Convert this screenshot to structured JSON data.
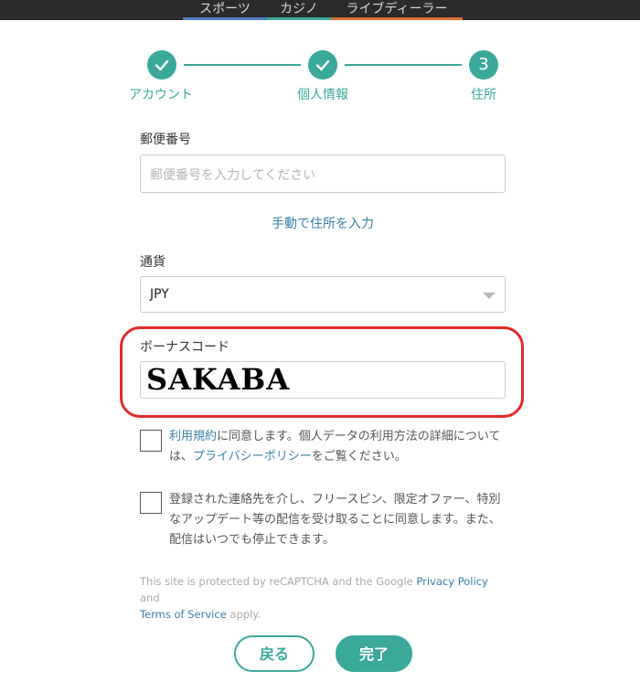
{
  "tabs": {
    "sports": "スポーツ",
    "casino": "カジノ",
    "live_dealer": "ライブディーラー"
  },
  "stepper": {
    "steps": [
      {
        "label": "アカウント",
        "state": "done"
      },
      {
        "label": "個人情報",
        "state": "done"
      },
      {
        "label": "住所",
        "state": "current",
        "number": "3"
      }
    ]
  },
  "postal": {
    "label": "郵便番号",
    "placeholder": "郵便番号を入力してください",
    "manual_link": "手動で住所を入力"
  },
  "currency": {
    "label": "通貨",
    "selected": "JPY"
  },
  "bonus": {
    "label": "ボーナスコード",
    "value": "SAKABA"
  },
  "terms": {
    "link1": "利用規約",
    "text1": "に同意します。個人データの利用方法の詳細については、",
    "link2": "プライバシーポリシー",
    "text2": "をご覧ください。"
  },
  "marketing": {
    "text": "登録された連絡先を介し、フリースピン、限定オファー、特別なアップデート等の配信を受け取ることに同意します。また、配信はいつでも停止できます。"
  },
  "recaptcha": {
    "text1": "This site is protected by reCAPTCHA and the Google ",
    "privacy": "Privacy Policy",
    "and": " and ",
    "terms": "Terms of Service",
    "text2": " apply."
  },
  "buttons": {
    "back": "戻る",
    "done": "完了"
  },
  "colors": {
    "accent": "#3aa99a",
    "link": "#3a7fa6",
    "highlight": "#e02a2a"
  }
}
